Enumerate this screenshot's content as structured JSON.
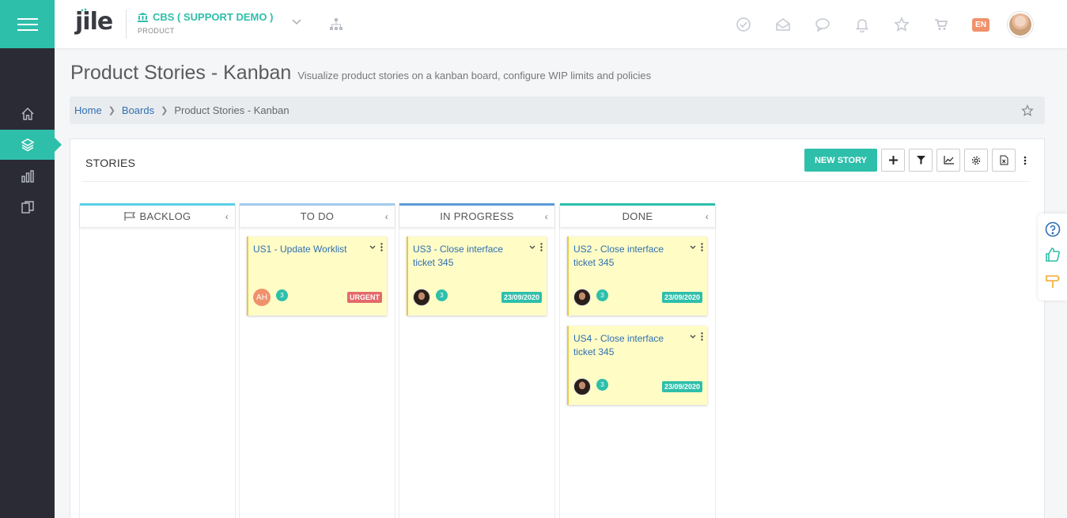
{
  "header": {
    "logo": "jile",
    "org_name": "CBS ( SUPPORT DEMO )",
    "org_sub": "PRODUCT",
    "lang": "EN",
    "icons": [
      "check-circle-icon",
      "inbox-icon",
      "chat-icon",
      "bell-icon",
      "star-icon",
      "cart-icon"
    ]
  },
  "sidebar": {
    "items": [
      "home-icon",
      "layers-icon",
      "bar-chart-icon",
      "documents-icon"
    ]
  },
  "page": {
    "title": "Product Stories - Kanban",
    "subtitle": "Visualize product stories on a kanban board, configure WIP limits and policies"
  },
  "breadcrumb": {
    "items": [
      "Home",
      "Boards"
    ],
    "current": "Product Stories - Kanban"
  },
  "panel": {
    "title": "STORIES",
    "new_story": "NEW STORY"
  },
  "columns": [
    {
      "name": "BACKLOG",
      "color": "#5ad1e6"
    },
    {
      "name": "TO DO",
      "color": "#a3c9ee"
    },
    {
      "name": "IN PROGRESS",
      "color": "#5b9bd8"
    },
    {
      "name": "DONE",
      "color": "#2ebfaa"
    }
  ],
  "cards": {
    "us1": {
      "title": "US1 - Update Worklist",
      "avatar": "AH",
      "count": "3",
      "badge": "URGENT"
    },
    "us3": {
      "title": "US3 - Close interface ticket 345",
      "count": "3",
      "badge": "23/09/2020"
    },
    "us2": {
      "title": "US2 - Close interface ticket 345",
      "count": "3",
      "badge": "23/09/2020"
    },
    "us4": {
      "title": "US4 - Close interface ticket 345",
      "count": "3",
      "badge": "23/09/2020"
    }
  },
  "colors": {
    "accent": "#2ebfaa",
    "sidebar": "#2b2b36",
    "card": "#fffcc6",
    "urgent": "#e46a6a"
  }
}
